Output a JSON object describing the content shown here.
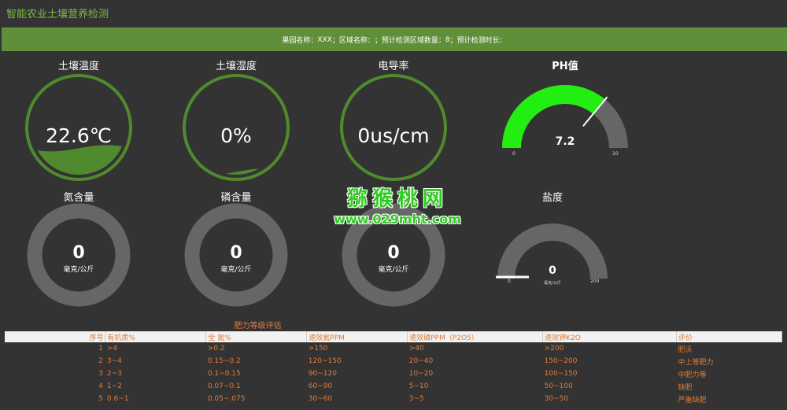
{
  "app": {
    "title": "智能农业土壤营养检测"
  },
  "info_bar": {
    "garden_label": "果园名称：",
    "garden_value": "XXX",
    "area_label": "；区域名称：",
    "area_value": "",
    "count_label": "；预计检测区域数量：",
    "count_value": "8",
    "duration_label": "；预计检测时长：",
    "duration_value": ""
  },
  "gauges": {
    "soil_temperature": {
      "title": "土壤温度",
      "value": "22.6℃",
      "fill_fraction": 0.28,
      "color": "#4f8a2e"
    },
    "soil_moisture": {
      "title": "土壤湿度",
      "value": "0%",
      "fill_fraction": 0.03,
      "color": "#4f8a2e"
    },
    "conductivity": {
      "title": "电导率",
      "value": "0us/cm",
      "fill_fraction": 0.0,
      "color": "#4f8a2e"
    },
    "ph": {
      "title": "PH值",
      "value": "7.2",
      "value_number": 7.2,
      "min": "0",
      "max": "10",
      "min_number": 0,
      "max_number": 10,
      "color": "#22ee11"
    },
    "nitrogen": {
      "title": "氮含量",
      "value": "0",
      "unit": "毫克/公斤"
    },
    "phosphorus": {
      "title": "磷含量",
      "value": "0",
      "unit": "毫克/公斤"
    },
    "potassium": {
      "title": "",
      "value": "0",
      "unit": "毫克/公斤"
    },
    "salinity": {
      "title": "盐度",
      "value": "0",
      "unit": "毫克/公斤",
      "value_number": 0,
      "min": "0",
      "max": "200",
      "min_number": 0,
      "max_number": 200
    }
  },
  "grade_table": {
    "title": "肥力等级评估",
    "headers": [
      "序号",
      "有机质%",
      "全 氮%",
      "速效氮PPM",
      "速效磷PPM（P2O5）",
      "速效钾K2O",
      "评价"
    ],
    "rows": [
      {
        "idx": "1",
        "organic": ">4",
        "total_n": ">0.2",
        "avail_n": ">150",
        "avail_p": ">40",
        "avail_k": ">200",
        "rating": "肥沃"
      },
      {
        "idx": "2",
        "organic": "3~4",
        "total_n": "0.15~0.2",
        "avail_n": "120~150",
        "avail_p": "20~40",
        "avail_k": "150~200",
        "rating": "中上等肥力"
      },
      {
        "idx": "3",
        "organic": "2~3",
        "total_n": "0.1~0.15",
        "avail_n": "90~120",
        "avail_p": "10~20",
        "avail_k": "100~150",
        "rating": "中肥力等"
      },
      {
        "idx": "4",
        "organic": "1~2",
        "total_n": "0.07~0.1",
        "avail_n": "60~90",
        "avail_p": "5~10",
        "avail_k": "50~100",
        "rating": "缺肥"
      },
      {
        "idx": "5",
        "organic": "0.6~1",
        "total_n": "0.05~.075",
        "avail_n": "30~60",
        "avail_p": "3~5",
        "avail_k": "30~50",
        "rating": "严重缺肥"
      }
    ]
  },
  "watermark": {
    "cn": "猕猴桃网",
    "url": "www.029mht.com"
  }
}
